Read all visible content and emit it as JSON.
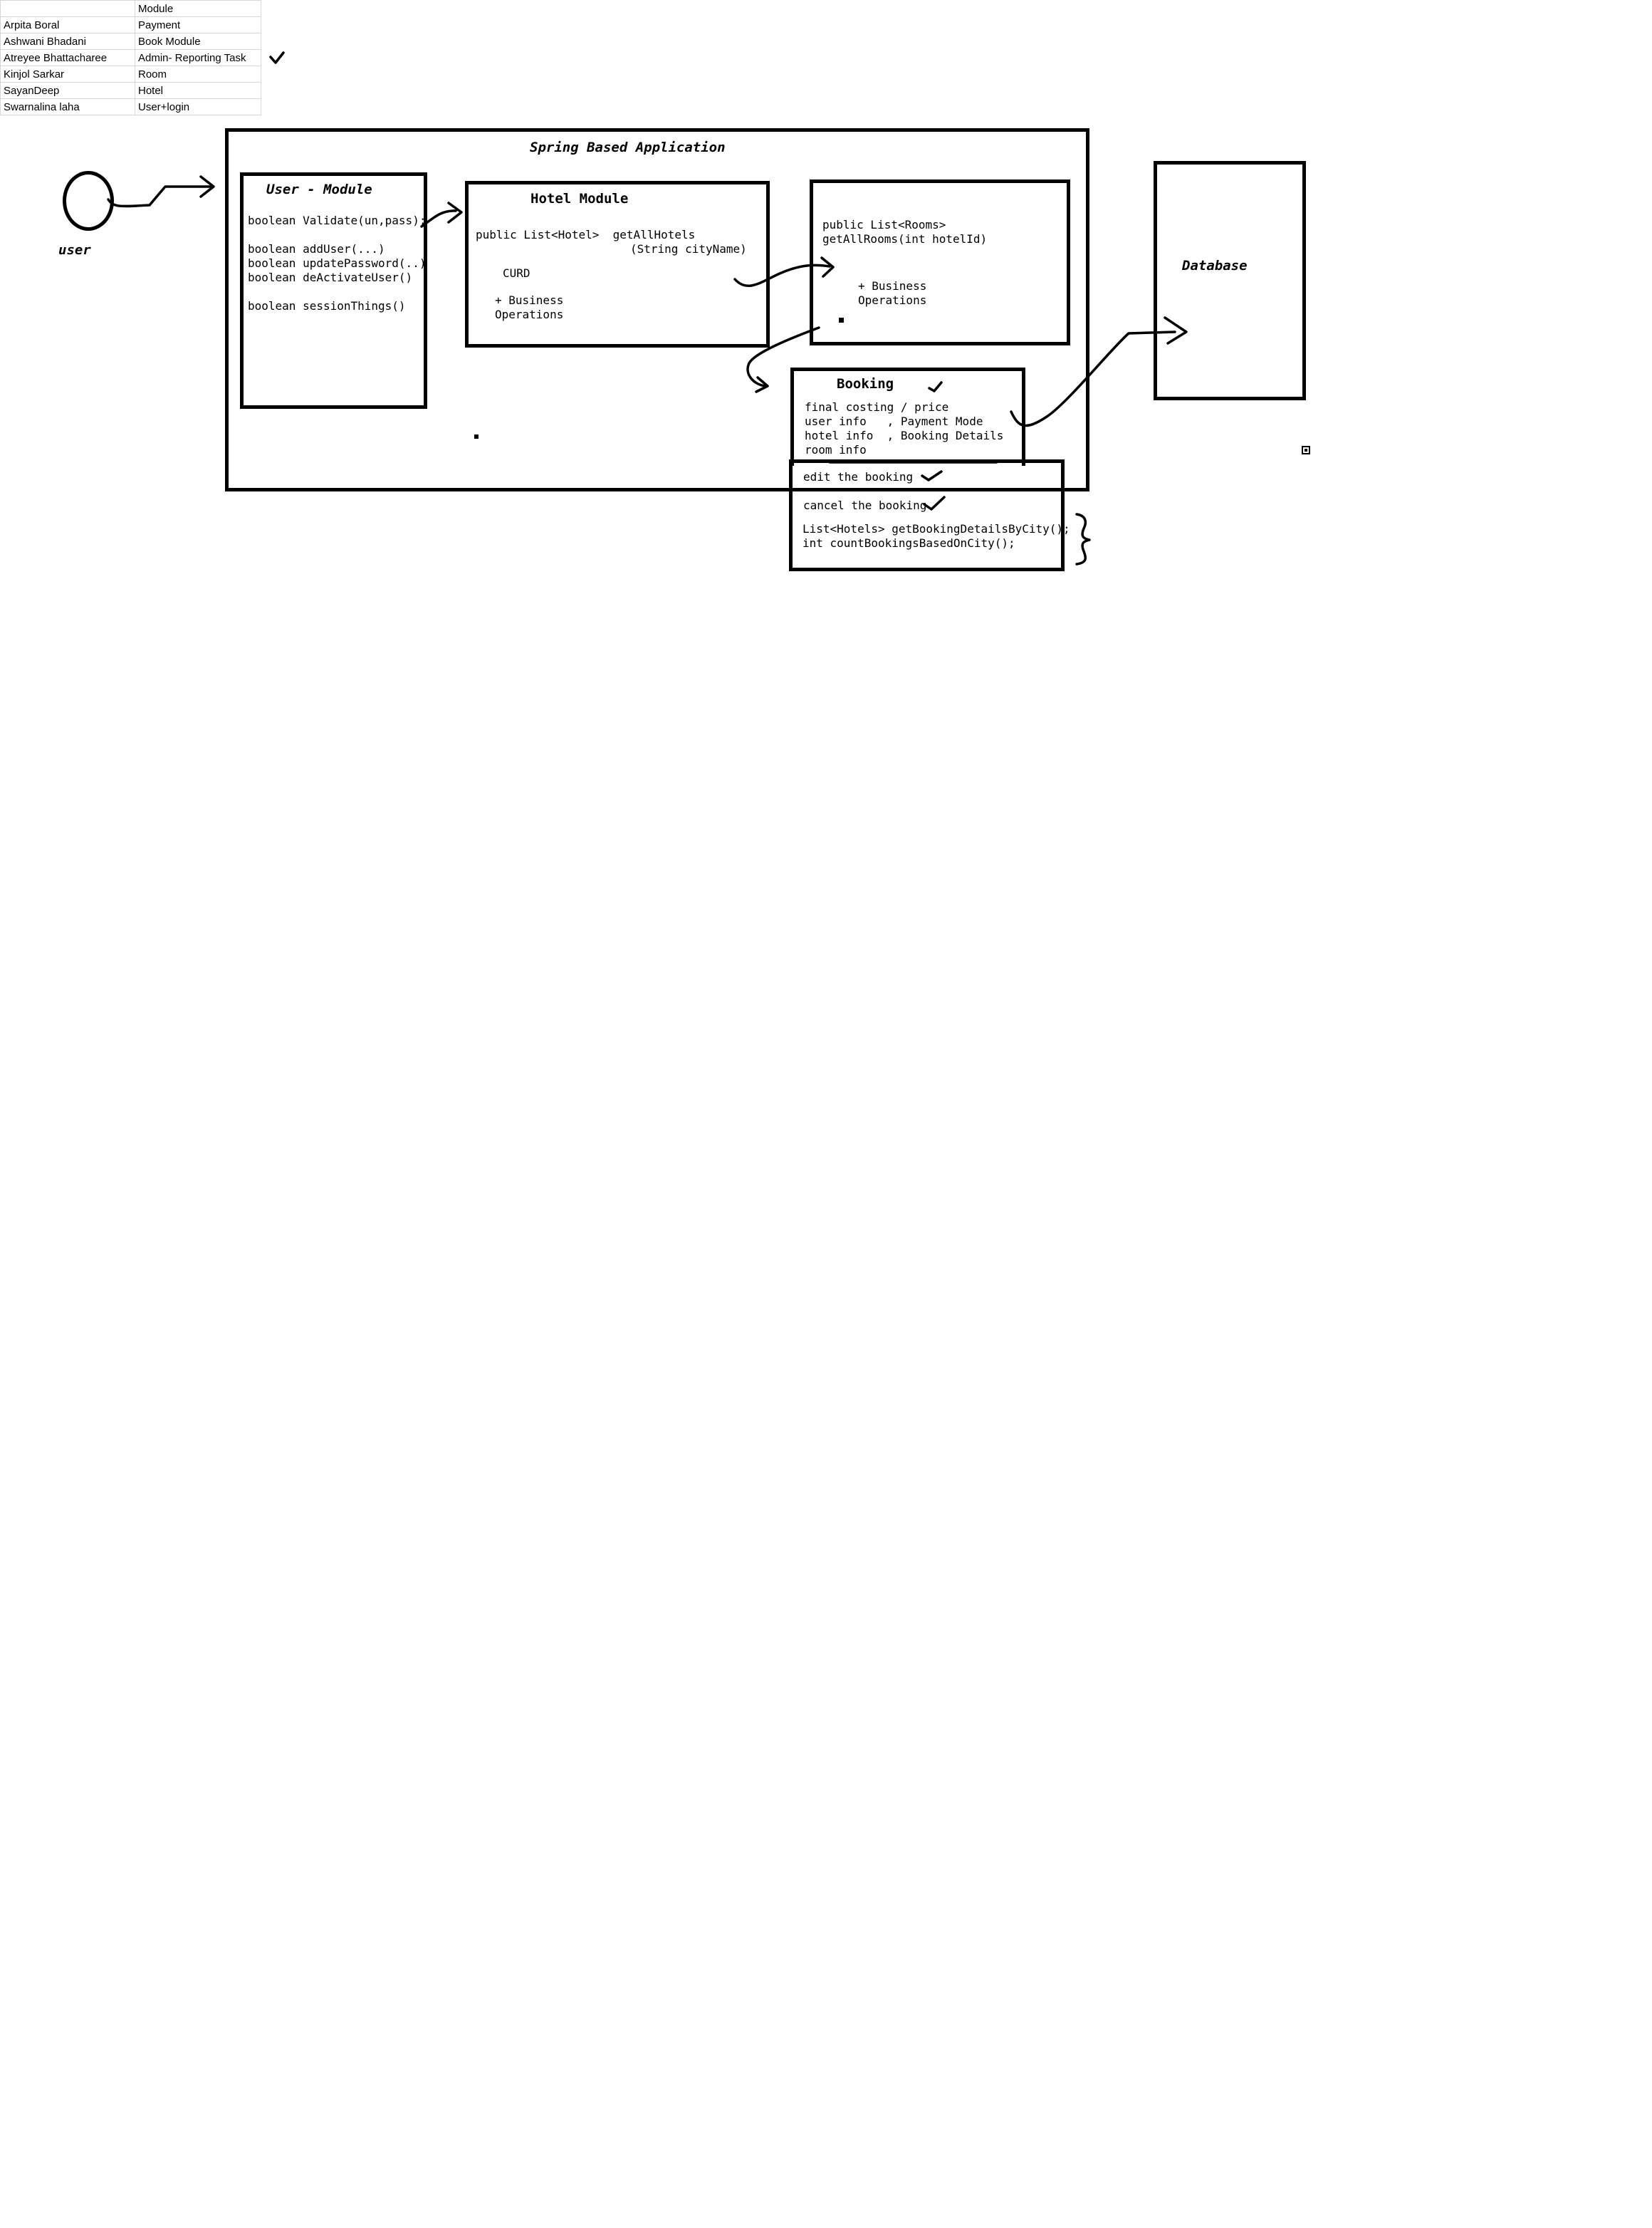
{
  "sheet": {
    "header": [
      "",
      "Module"
    ],
    "rows": [
      [
        "Arpita Boral",
        "Payment"
      ],
      [
        "Ashwani Bhadani",
        "Book Module"
      ],
      [
        "Atreyee Bhattacharee",
        "Admin- Reporting Task"
      ],
      [
        "Kinjol Sarkar",
        "Room"
      ],
      [
        "SayanDeep",
        "Hotel"
      ],
      [
        "Swarnalina laha",
        "User+login"
      ]
    ]
  },
  "actor": {
    "label": "user"
  },
  "app": {
    "title": "Spring Based Application"
  },
  "user_module": {
    "title": "User - Module",
    "lines": [
      "boolean Validate(un,pass);",
      "",
      "boolean addUser(...)",
      "boolean updatePassword(..)",
      "boolean deActivateUser()",
      "",
      "boolean sessionThings()"
    ]
  },
  "hotel_module": {
    "title": "Hotel Module",
    "line1": "public List<Hotel>  getAllHotels",
    "line2": "(String cityName)",
    "curd": "CURD",
    "biz1": "+ Business",
    "biz2": "Operations"
  },
  "room_module": {
    "line1": "public List<Rooms>",
    "line2": "getAllRooms(int hotelId)",
    "biz1": "+ Business",
    "biz2": "Operations"
  },
  "booking": {
    "title": "Booking",
    "lines": [
      "final costing / price",
      "user info   , Payment Mode",
      "hotel info  , Booking Details",
      "room info"
    ],
    "edit": "edit the booking",
    "cancel": "cancel the booking",
    "report1": "List<Hotels> getBookingDetailsByCity();",
    "report2": "int countBookingsBasedOnCity();"
  },
  "database": {
    "label": "Database"
  }
}
